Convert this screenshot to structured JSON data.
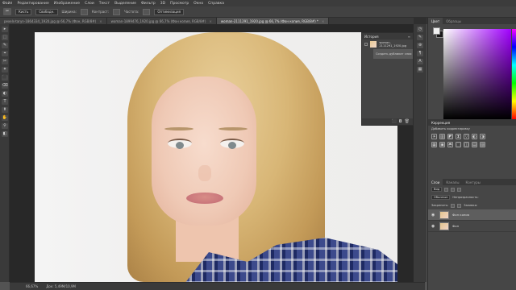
{
  "menu": [
    "Файл",
    "Редактирование",
    "Изображение",
    "Слои",
    "Текст",
    "Выделение",
    "Фильтр",
    "3D",
    "Просмотр",
    "Окно",
    "Справка"
  ],
  "options": {
    "tool_glyph": "✂",
    "mode": "Кисть",
    "mode2": "Свободн.",
    "label1": "Ширина:",
    "label2": "Контраст:",
    "label3": "Частота:",
    "button": "Оптимизация"
  },
  "tabs": [
    {
      "label": "pexels-taryn-1864334_1920.jpg @ 66,7% (Фон, RGB/8#)",
      "active": false
    },
    {
      "label": "woman-1899476_1920.jpg @ 66,7% (Фон копия, RGB/8#)",
      "active": false
    },
    {
      "label": "woman-2111291_1920.jpg @ 66,7% (Фон копия, RGB/8#) *",
      "active": true
    }
  ],
  "tab_close": "×",
  "toolbar_glyphs": [
    "▸",
    "⬚",
    "✎",
    "⌖",
    "✂",
    "✦",
    "⬛",
    "⌫",
    "◐",
    "T",
    "⬆",
    "✋",
    "⚲",
    "◧"
  ],
  "history": {
    "title": "История",
    "menu_glyph": "≡",
    "snapshot": "woman-2111291_1920.jpg",
    "step": "Создать дубликат слоя",
    "footer_glyphs": [
      "⬛",
      "◘",
      "🗑"
    ]
  },
  "dock_glyphs": [
    "◷",
    "✎",
    "⊕",
    "¶",
    "A",
    "▦"
  ],
  "color_panel": {
    "tabs": [
      "Цвет",
      "Образцы"
    ]
  },
  "adjustments": {
    "title": "Коррекция",
    "subtitle": "Добавить корректировку",
    "icons": [
      "☀",
      "▥",
      "◩",
      "⧗",
      "▽",
      "◐",
      "◑",
      "▦",
      "▣",
      "◓",
      "⬚",
      "◫",
      "▤",
      "▨"
    ]
  },
  "layers_panel": {
    "tabs": [
      "Слои",
      "Каналы",
      "Контуры"
    ],
    "kind_label": "Вид",
    "blend_mode": "Обычные",
    "opacity_label": "Непрозрачность:",
    "lock_label": "Закрепить:",
    "fill_label": "Заливка:",
    "layers": [
      {
        "name": "Фон копия",
        "active": true
      },
      {
        "name": "Фон",
        "active": false
      }
    ],
    "eye_glyph": "◉"
  },
  "status": {
    "zoom": "66,67%",
    "doc": "Док: 5,49M/10,9M"
  }
}
